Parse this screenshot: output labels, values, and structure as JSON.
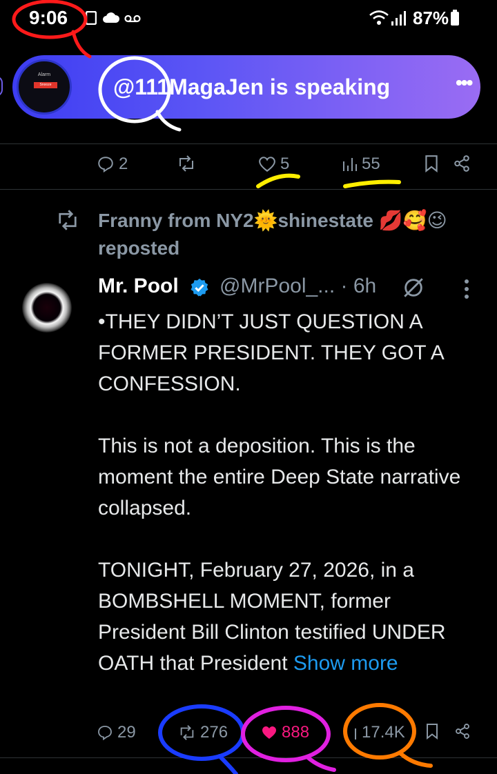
{
  "status_bar": {
    "time": "9:06",
    "battery": "87%",
    "icons": [
      "photo-icon",
      "cloud-icon",
      "voicemail-icon",
      "wifi-icon",
      "signal-icon",
      "battery-icon"
    ]
  },
  "space_banner": {
    "thumb_title": "Alarm",
    "thumb_button": "Snooze",
    "speaker_text": "@111MagaJen is speaking",
    "menu": "•••"
  },
  "prev_tweet_actions": {
    "replies": "2",
    "reposts": "",
    "likes": "5",
    "views": "55"
  },
  "repost_header": {
    "text": "Franny from NY2🌞shinestate 💋🥰😉 reposted"
  },
  "tweet": {
    "author_name": "Mr. Pool",
    "handle_time": "@MrPool_... · 6h",
    "body": "•THEY DIDN’T JUST QUESTION A FORMER PRESIDENT. THEY GOT A CONFESSION.\n\nThis is not a deposition. This is the moment the entire Deep State narrative collapsed.\n\nTONIGHT, February 27, 2026, in a BOMBSHELL MOMENT, former President Bill Clinton testified UNDER OATH that President ",
    "show_more": "Show more",
    "replies": "29",
    "reposts": "276",
    "likes": "888",
    "views": "17.4K"
  },
  "colors": {
    "accent": "#1d9bf0",
    "like": "#f91880",
    "muted": "#8b98a5",
    "banner_start": "#3d3df2",
    "banner_end": "#9a6cf3",
    "anno_red": "#ff1a1a",
    "anno_white": "#ffffff",
    "anno_yellow": "#ffee00",
    "anno_blue": "#1a3cff",
    "anno_magenta": "#e020e0",
    "anno_orange": "#ff7a00"
  }
}
